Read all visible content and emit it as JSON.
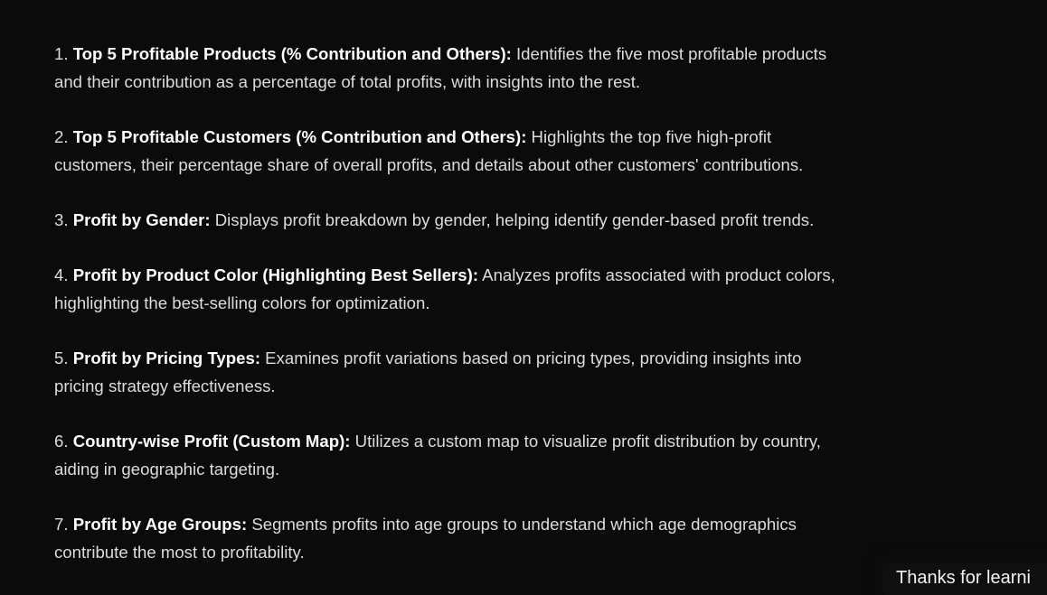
{
  "items": [
    {
      "num": "1.",
      "title": "Top 5 Profitable Products (% Contribution and Others):",
      "line1": " Identifies the five most profitable products",
      "line2": "and their contribution as a percentage of total profits, with insights into the rest."
    },
    {
      "num": "2.",
      "title": "Top 5 Profitable Customers (% Contribution and Others):",
      "line1": " Highlights the top five high-profit",
      "line2": "customers, their percentage share of overall profits, and details about other customers' contributions."
    },
    {
      "num": "3.",
      "title": "Profit by Gender:",
      "line1": " Displays profit breakdown by gender, helping identify gender-based profit trends.",
      "line2": null
    },
    {
      "num": "4.",
      "title": "Profit by Product Color (Highlighting Best Sellers):",
      "line1": " Analyzes profits associated with product colors,",
      "line2": "highlighting the best-selling colors for optimization."
    },
    {
      "num": "5.",
      "title": "Profit by Pricing Types:",
      "line1": " Examines profit variations based on pricing types, providing insights into",
      "line2": "pricing strategy effectiveness."
    },
    {
      "num": "6.",
      "title": "Country-wise Profit (Custom Map):",
      "line1": " Utilizes a custom map to visualize profit distribution by country,",
      "line2": "aiding in geographic targeting."
    },
    {
      "num": "7.",
      "title": "Profit by Age Groups:",
      "line1": " Segments profits into age groups to understand which age demographics",
      "line2": "contribute the most to profitability."
    }
  ],
  "caption": "Thanks for learni"
}
